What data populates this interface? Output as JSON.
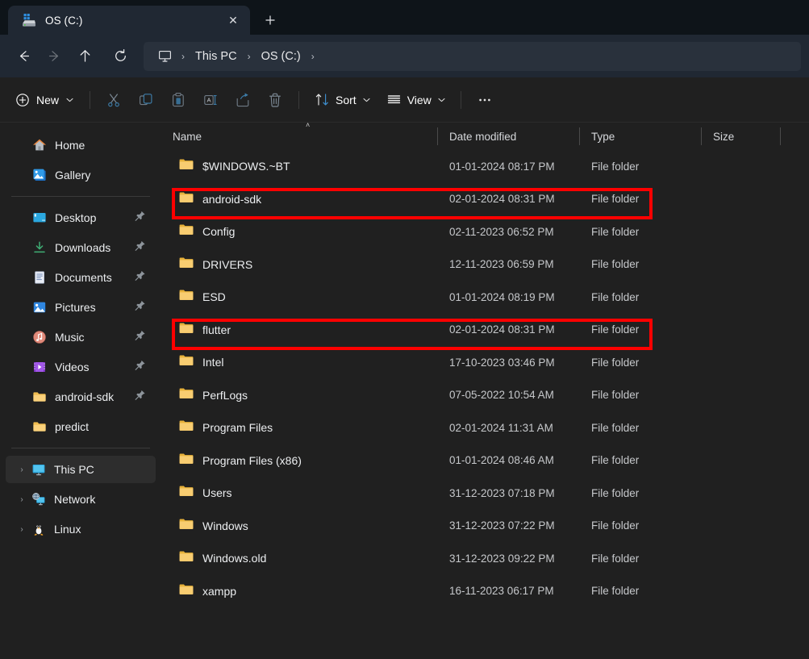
{
  "window": {
    "tab": {
      "title": "OS (C:)",
      "icon": "windows-drive-icon",
      "close_label": "✕"
    },
    "new_tab_label": "＋"
  },
  "nav": {
    "back_label": "←",
    "forward_label": "→",
    "up_label": "↑",
    "refresh_label": "↻",
    "breadcrumb": {
      "root_icon": "this-pc-monitor-icon",
      "items": [
        "This PC",
        "OS (C:)"
      ],
      "separator": "›"
    }
  },
  "toolbar": {
    "new_label": "New",
    "new_chevron": "･",
    "cut_label": "Cut",
    "copy_label": "Copy",
    "paste_label": "Paste",
    "rename_label": "Rename",
    "share_label": "Share",
    "delete_label": "Delete",
    "sort_label": "Sort",
    "view_label": "View",
    "more_label": "•••",
    "chevron": "･"
  },
  "sidebar": {
    "quick": [
      {
        "label": "Home",
        "icon": "home-icon",
        "pinned": false
      },
      {
        "label": "Gallery",
        "icon": "gallery-icon",
        "pinned": false
      }
    ],
    "pinned": [
      {
        "label": "Desktop",
        "icon": "desktop-icon",
        "pinned": true
      },
      {
        "label": "Downloads",
        "icon": "downloads-icon",
        "pinned": true
      },
      {
        "label": "Documents",
        "icon": "documents-icon",
        "pinned": true
      },
      {
        "label": "Pictures",
        "icon": "pictures-icon",
        "pinned": true
      },
      {
        "label": "Music",
        "icon": "music-icon",
        "pinned": true
      },
      {
        "label": "Videos",
        "icon": "videos-icon",
        "pinned": true
      },
      {
        "label": "android-sdk",
        "icon": "folder-icon",
        "pinned": true
      },
      {
        "label": "predict",
        "icon": "folder-icon",
        "pinned": false
      }
    ],
    "tree": [
      {
        "label": "This PC",
        "icon": "this-pc-icon",
        "expander": "›",
        "selected": true
      },
      {
        "label": "Network",
        "icon": "network-icon",
        "expander": "›",
        "selected": false
      },
      {
        "label": "Linux",
        "icon": "linux-icon",
        "expander": "›",
        "selected": false
      }
    ]
  },
  "file_list": {
    "columns": [
      "Name",
      "Date modified",
      "Type",
      "Size"
    ],
    "sort": {
      "column": "Name",
      "direction": "ascending",
      "caret": "˄"
    },
    "rows": [
      {
        "name": "$WINDOWS.~BT",
        "date": "01-01-2024 08:17 PM",
        "type": "File folder",
        "size": "",
        "highlighted": false
      },
      {
        "name": "android-sdk",
        "date": "02-01-2024 08:31 PM",
        "type": "File folder",
        "size": "",
        "highlighted": true
      },
      {
        "name": "Config",
        "date": "02-11-2023 06:52 PM",
        "type": "File folder",
        "size": "",
        "highlighted": false
      },
      {
        "name": "DRIVERS",
        "date": "12-11-2023 06:59 PM",
        "type": "File folder",
        "size": "",
        "highlighted": false
      },
      {
        "name": "ESD",
        "date": "01-01-2024 08:19 PM",
        "type": "File folder",
        "size": "",
        "highlighted": false
      },
      {
        "name": "flutter",
        "date": "02-01-2024 08:31 PM",
        "type": "File folder",
        "size": "",
        "highlighted": true
      },
      {
        "name": "Intel",
        "date": "17-10-2023 03:46 PM",
        "type": "File folder",
        "size": "",
        "highlighted": false
      },
      {
        "name": "PerfLogs",
        "date": "07-05-2022 10:54 AM",
        "type": "File folder",
        "size": "",
        "highlighted": false
      },
      {
        "name": "Program Files",
        "date": "02-01-2024 11:31 AM",
        "type": "File folder",
        "size": "",
        "highlighted": false
      },
      {
        "name": "Program Files (x86)",
        "date": "01-01-2024 08:46 AM",
        "type": "File folder",
        "size": "",
        "highlighted": false
      },
      {
        "name": "Users",
        "date": "31-12-2023 07:18 PM",
        "type": "File folder",
        "size": "",
        "highlighted": false
      },
      {
        "name": "Windows",
        "date": "31-12-2023 07:22 PM",
        "type": "File folder",
        "size": "",
        "highlighted": false
      },
      {
        "name": "Windows.old",
        "date": "31-12-2023 09:22 PM",
        "type": "File folder",
        "size": "",
        "highlighted": false
      },
      {
        "name": "xampp",
        "date": "16-11-2023 06:17 PM",
        "type": "File folder",
        "size": "",
        "highlighted": false
      }
    ]
  },
  "colors": {
    "annotation": "#fe0000",
    "window_bg": "#202020",
    "chrome_bg": "#202833",
    "titlebar_bg": "#0e1419",
    "folder_yellow": "#f3bd4e"
  }
}
